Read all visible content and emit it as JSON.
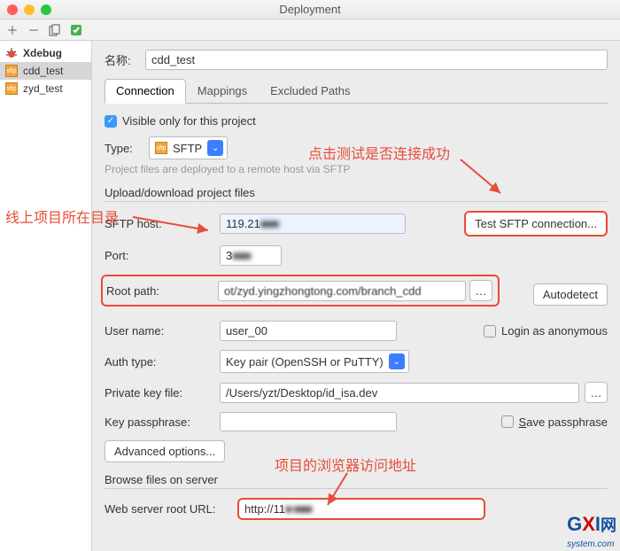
{
  "window": {
    "title": "Deployment"
  },
  "sidebar": {
    "items": [
      {
        "label": "Xdebug"
      },
      {
        "label": "cdd_test"
      },
      {
        "label": "zyd_test"
      }
    ]
  },
  "nameRow": {
    "label": "名称:",
    "value": "cdd_test"
  },
  "tabs": {
    "connection": "Connection",
    "mappings": "Mappings",
    "excluded": "Excluded Paths"
  },
  "visibleOnly": "Visible only for this project",
  "typeRow": {
    "label": "Type:",
    "value": "SFTP"
  },
  "typeHint": "Project files are deployed to a remote host via SFTP",
  "sectionUpload": "Upload/download project files",
  "host": {
    "label": "SFTP host:",
    "value": "119.21",
    "obscured": "■■■"
  },
  "testBtn": "Test SFTP connection...",
  "port": {
    "label": "Port:",
    "value": "3",
    "obscured": "■■■"
  },
  "root": {
    "label": "Root path:",
    "value": "ot/zyd.yingzhongtong.com/branch_cdd"
  },
  "autodetect": "Autodetect",
  "user": {
    "label": "User name:",
    "value": "user_00"
  },
  "anon": "Login as anonymous",
  "auth": {
    "label": "Auth type:",
    "value": "Key pair (OpenSSH or PuTTY)"
  },
  "pkey": {
    "label": "Private key file:",
    "value": "/Users/yzt/Desktop/id_isa.dev"
  },
  "passphrase": {
    "label": "Key passphrase:"
  },
  "savePass": "Save passphrase",
  "advanced": "Advanced options...",
  "sectionBrowse": "Browse files on server",
  "webroot": {
    "label": "Web server root URL:",
    "value": "http://11",
    "obscured": "■ ■■■"
  },
  "anno": {
    "left": "线上项目所在目录",
    "top": "点击测试是否连接成功",
    "bottom": "项目的浏览器访问地址"
  },
  "watermark": {
    "brand": "GXI",
    "wang": "网",
    "sub": "system.com"
  }
}
